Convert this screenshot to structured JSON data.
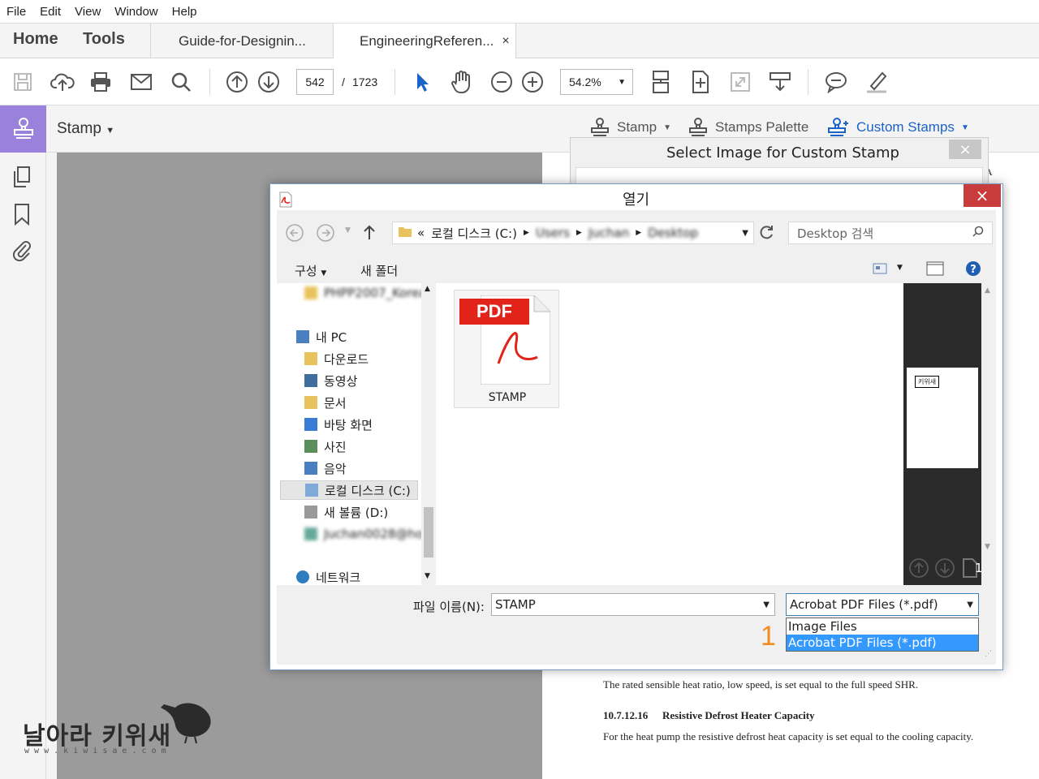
{
  "menu": {
    "file": "File",
    "edit": "Edit",
    "view": "View",
    "window": "Window",
    "help": "Help"
  },
  "nav": {
    "home": "Home",
    "tools": "Tools"
  },
  "tabs": [
    {
      "label": "Guide-for-Designin..."
    },
    {
      "label": "EngineeringReferen...",
      "close": "×"
    }
  ],
  "toolbar": {
    "page_current": "542",
    "page_separator": "/",
    "page_total": "1723",
    "zoom": "54.2%"
  },
  "stampbar": {
    "title": "Stamp",
    "stamp_label": "Stamp",
    "palette_label": "Stamps Palette",
    "custom_label": "Custom Stamps"
  },
  "select_window": {
    "title": "Select Image for Custom Stamp",
    "close": "×"
  },
  "dialog": {
    "title": "열기",
    "close": "×",
    "address": {
      "prefix": "«",
      "segment1": "로컬 디스크 (C:)",
      "segment2": "Users",
      "segment3": "Juchan",
      "segment4": "Desktop"
    },
    "search_placeholder": "Desktop 검색",
    "organize": "구성",
    "new_folder": "새 폴더",
    "tree": [
      {
        "label": "PHPP2007_Korea",
        "blurred": true
      },
      {
        "label": "내 PC"
      },
      {
        "label": "다운로드"
      },
      {
        "label": "동영상"
      },
      {
        "label": "문서"
      },
      {
        "label": "바탕 화면"
      },
      {
        "label": "사진"
      },
      {
        "label": "음악"
      },
      {
        "label": "로컬 디스크 (C:)"
      },
      {
        "label": "새 볼륨 (D:)"
      },
      {
        "label": "Juchan0028@hom",
        "blurred": true
      },
      {
        "label": "네트워크"
      }
    ],
    "file": {
      "badge": "PDF",
      "name": "STAMP"
    },
    "preview": {
      "stamp_text": "키위새",
      "page_number": "1"
    },
    "filename_label": "파일 이름(N):",
    "filename_value": "STAMP",
    "filetype_value": "Acrobat PDF Files (*.pdf)",
    "filetype_options": [
      "Image Files (*.jpg,*.gif,*.png,*.tif)",
      "Acrobat PDF Files (*.pdf)"
    ],
    "annotation": "1"
  },
  "document": {
    "corner_letter": "A",
    "para1": "The rated sensible heat ratio, low speed, is set equal to the full speed SHR.",
    "heading_num": "10.7.12.16",
    "heading": "Resistive Defrost Heater Capacity",
    "para2": "For the heat pump the resistive defrost heat capacity is set equal to the cooling capacity."
  },
  "watermark": {
    "title": "날아라 키위새",
    "url": "w w w . k i w i s a e . c o m"
  },
  "colors": {
    "accent": "#9a82dc",
    "selection": "#3399ff",
    "adobe_red": "#e2231a",
    "custom_blue": "#1a63c7",
    "annotation": "#f28b20"
  }
}
